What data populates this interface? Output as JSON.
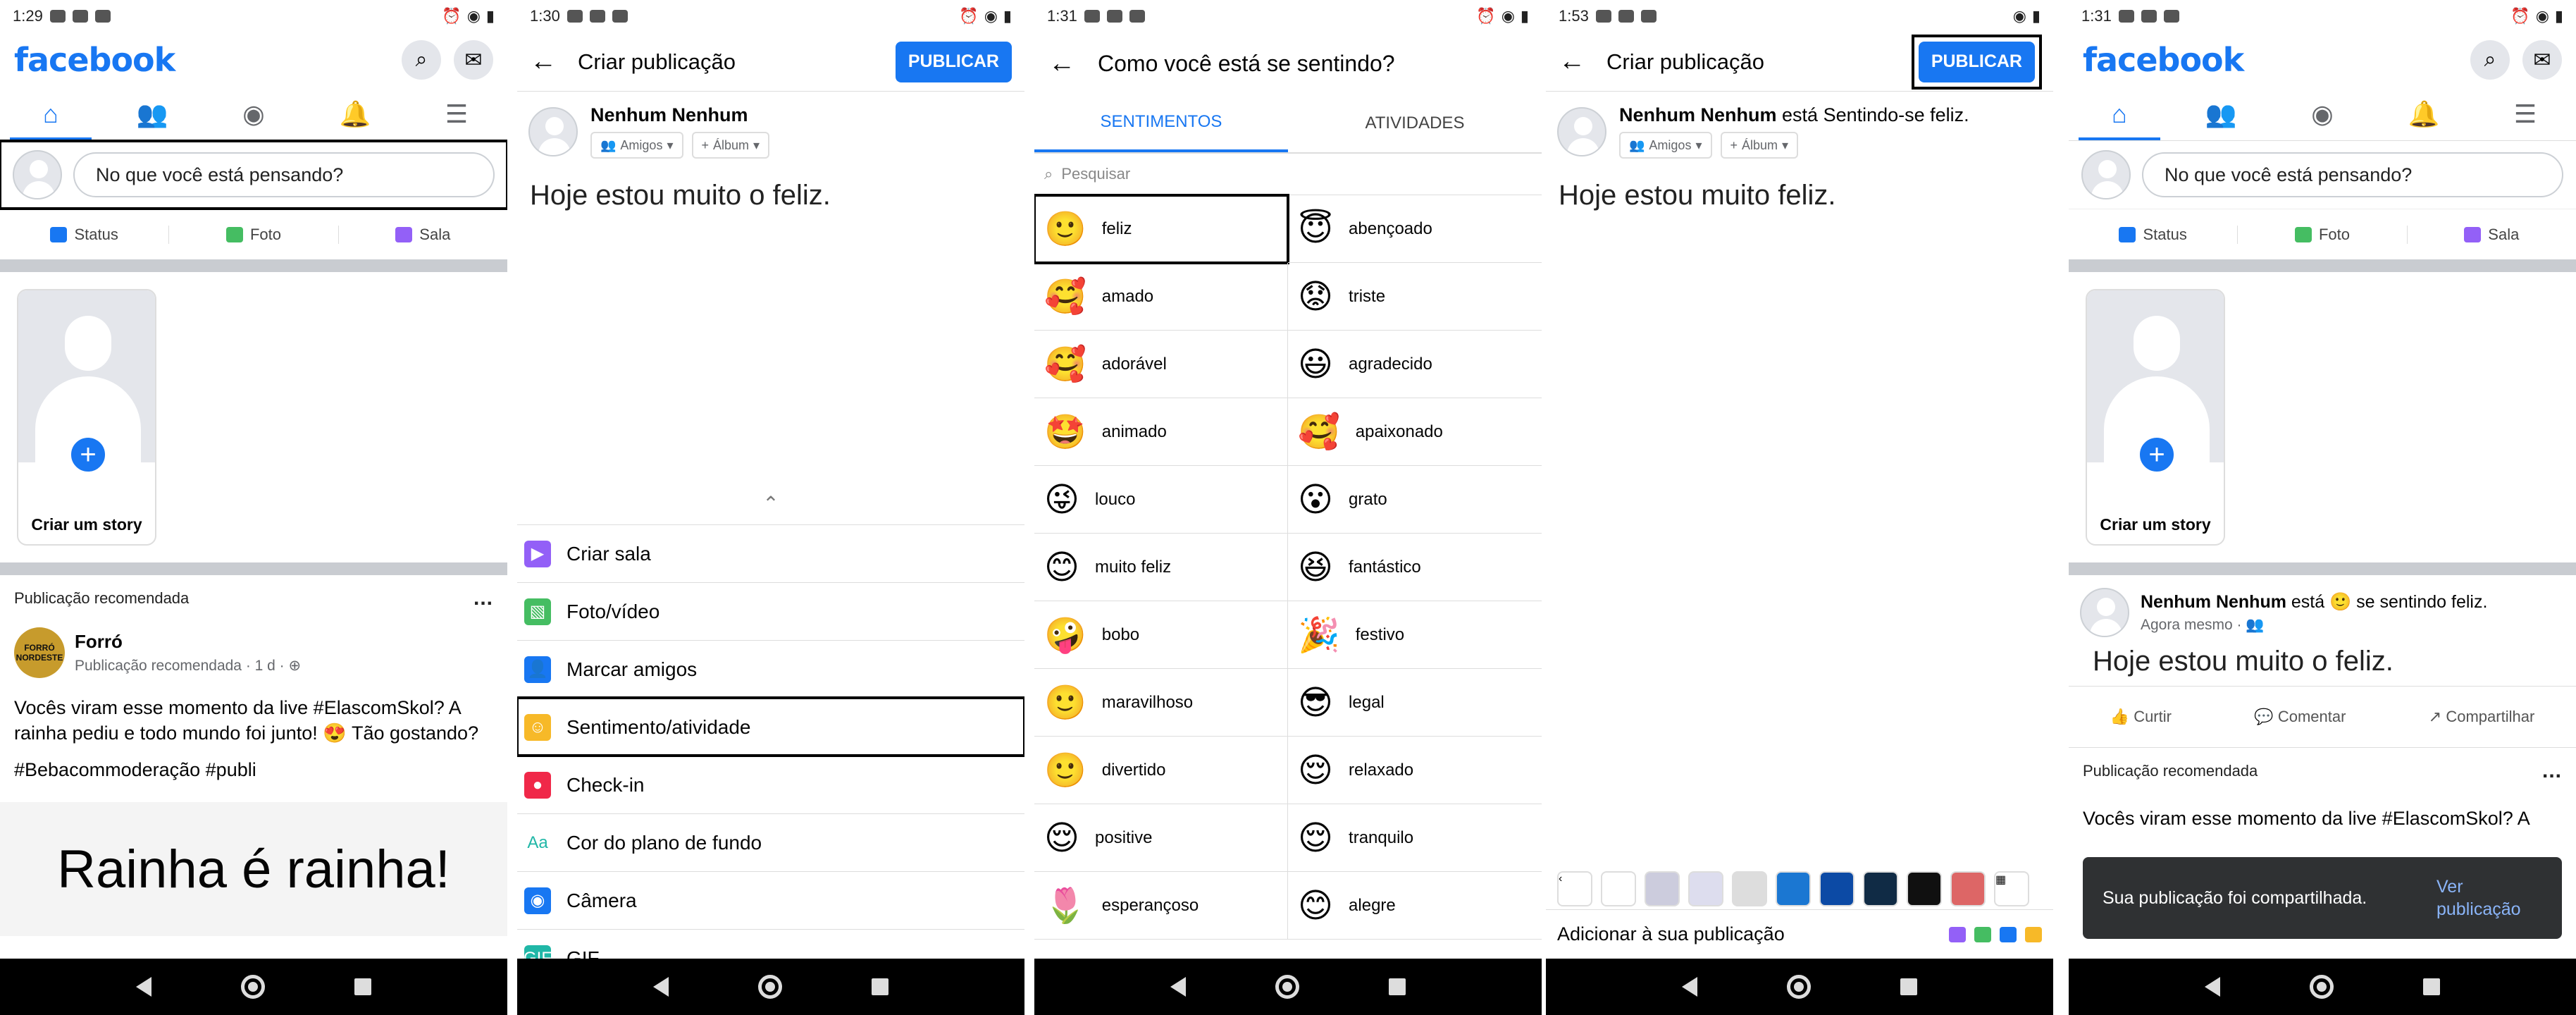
{
  "colors": {
    "brand": "#1877f2",
    "background": "#ffffff",
    "separator": "#c9ccd1"
  },
  "screens": [
    {
      "time": "1:29",
      "title": "facebook",
      "composer": "No que você está pensando?",
      "actions": [
        "Status",
        "Foto",
        "Sala"
      ],
      "story_label": "Criar um story",
      "recommended": "Publicação recomendada",
      "author": "Forró",
      "author_meta": "Publicação recomendada · 1 d · ⊕",
      "post": "Vocês viram esse momento da live #ElascomSkol? A rainha pediu e todo mundo foi junto! 😍 Tão gostando?",
      "hashtags": "#Bebacommoderação #publi",
      "image_text": "Rainha é rainha!"
    },
    {
      "time": "1:30",
      "title": "Criar publicação",
      "publish": "PUBLICAR",
      "user": "Nenhum Nenhum",
      "friends": "Amigos",
      "album": "Álbum",
      "text": "Hoje estou muito o feliz.",
      "menu": [
        "Criar sala",
        "Foto/vídeo",
        "Marcar amigos",
        "Sentimento/atividade",
        "Check-in",
        "Cor do plano de fundo",
        "Câmera",
        "GIF"
      ]
    },
    {
      "time": "1:31",
      "title": "Como você está se sentindo?",
      "tabs": [
        "SENTIMENTOS",
        "ATIVIDADES"
      ],
      "search": "Pesquisar",
      "feelings": [
        {
          "emoji": "🙂",
          "label": "feliz"
        },
        {
          "emoji": "😇",
          "label": "abençoado"
        },
        {
          "emoji": "🥰",
          "label": "amado"
        },
        {
          "emoji": "😟",
          "label": "triste"
        },
        {
          "emoji": "🥰",
          "label": "adorável"
        },
        {
          "emoji": "😃",
          "label": "agradecido"
        },
        {
          "emoji": "🤩",
          "label": "animado"
        },
        {
          "emoji": "🥰",
          "label": "apaixonado"
        },
        {
          "emoji": "😜",
          "label": "louco"
        },
        {
          "emoji": "😮",
          "label": "grato"
        },
        {
          "emoji": "😊",
          "label": "muito feliz"
        },
        {
          "emoji": "😆",
          "label": "fantástico"
        },
        {
          "emoji": "🤪",
          "label": "bobo"
        },
        {
          "emoji": "🎉",
          "label": "festivo"
        },
        {
          "emoji": "🙂",
          "label": "maravilhoso"
        },
        {
          "emoji": "😎",
          "label": "legal"
        },
        {
          "emoji": "🙂",
          "label": "divertido"
        },
        {
          "emoji": "😌",
          "label": "relaxado"
        },
        {
          "emoji": "😌",
          "label": "positive"
        },
        {
          "emoji": "😌",
          "label": "tranquilo"
        },
        {
          "emoji": "🌷",
          "label": "esperançoso"
        },
        {
          "emoji": "😊",
          "label": "alegre"
        }
      ]
    },
    {
      "time": "1:53",
      "title": "Criar publicação",
      "publish": "PUBLICAR",
      "user": "Nenhum Nenhum",
      "status": "está  Sentindo-se feliz.",
      "friends": "Amigos",
      "album": "Álbum",
      "text": "Hoje estou muito feliz.",
      "add": "Adicionar à sua publicação"
    },
    {
      "time": "1:31",
      "title": "facebook",
      "composer": "No que você está pensando?",
      "actions": [
        "Status",
        "Foto",
        "Sala"
      ],
      "story_label": "Criar um story",
      "user": "Nenhum Nenhum",
      "feeling": "está 🙂 se sentindo feliz.",
      "meta": "Agora mesmo · 👥",
      "text": "Hoje estou muito o feliz.",
      "reactions": [
        "Curtir",
        "Comentar",
        "Compartilhar"
      ],
      "recommended": "Publicação recomendada",
      "toast": "Sua publicação foi compartilhada.",
      "toast_link": "Ver publicação",
      "feed_text": "Vocês viram esse momento da live #ElascomSkol? A"
    }
  ]
}
